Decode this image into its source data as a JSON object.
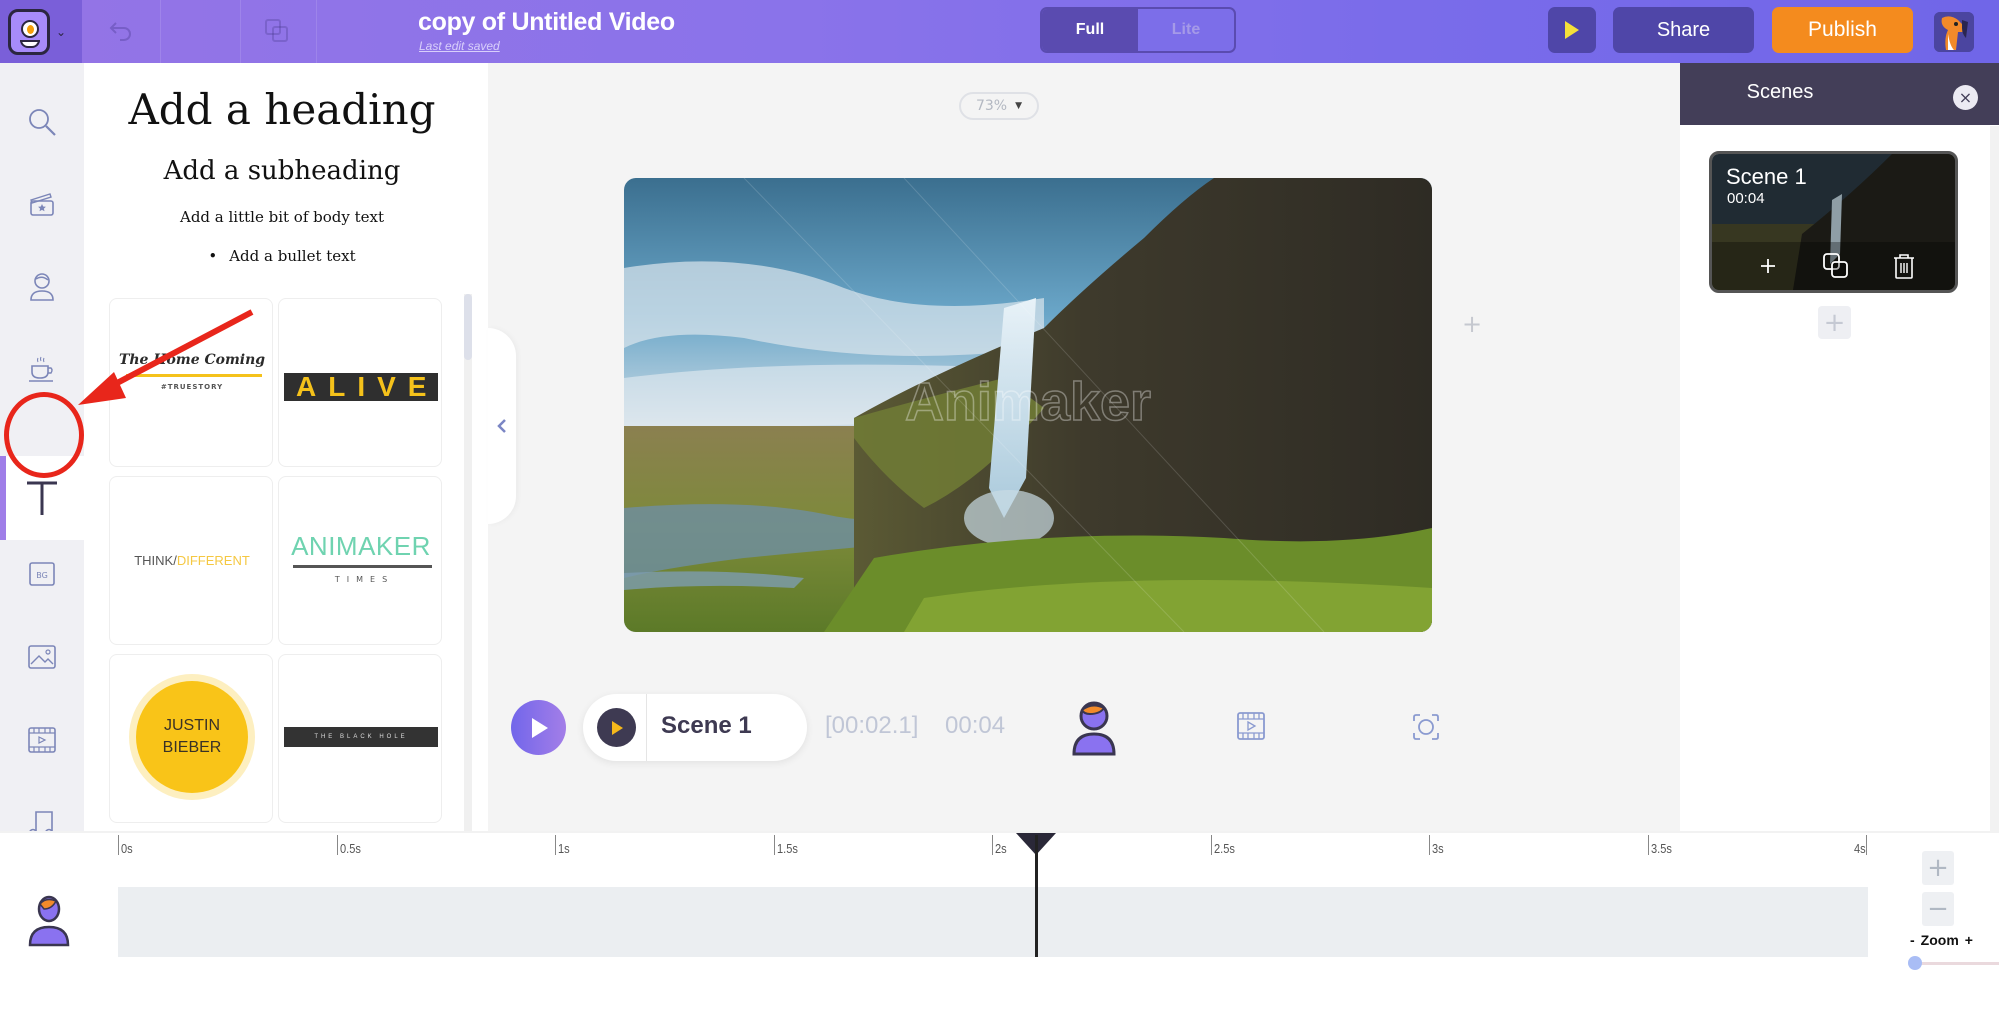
{
  "app": {
    "title": "copy of Untitled Video",
    "save_status": "Last edit saved"
  },
  "toolbar": {
    "mode_options": [
      "Full",
      "Lite"
    ],
    "mode_selected": "Full",
    "share_label": "Share",
    "publish_label": "Publish",
    "icons": [
      "app-logo-icon",
      "undo-icon",
      "duplicate-icon",
      "preview-play-icon",
      "user-avatar-icon"
    ]
  },
  "leftnav": {
    "items": [
      {
        "name": "search",
        "icon": "search-icon"
      },
      {
        "name": "scenes-templates",
        "icon": "clapperboard-star-icon"
      },
      {
        "name": "characters",
        "icon": "character-icon"
      },
      {
        "name": "properties",
        "icon": "coffee-cup-icon"
      },
      {
        "name": "text",
        "icon": "text-t-icon",
        "active": true
      },
      {
        "name": "backgrounds",
        "icon": "bg-icon",
        "label": "BG"
      },
      {
        "name": "images",
        "icon": "image-icon"
      },
      {
        "name": "videos",
        "icon": "film-icon"
      },
      {
        "name": "music",
        "icon": "music-note-icon"
      }
    ]
  },
  "textpanel": {
    "heading": "Add a heading",
    "subheading": "Add a subheading",
    "body": "Add a little bit of body text",
    "bullet": "Add a bullet text",
    "templates": [
      {
        "title": "The Home Coming",
        "subtitle": "#TRUESTORY"
      },
      {
        "title": "ALIVE"
      },
      {
        "title_part1": "THINK/",
        "title_part2": "DIFFERENT"
      },
      {
        "title": "ANIMAKER",
        "subtitle": "TIMES"
      },
      {
        "line1": "JUSTIN",
        "line2": "BIEBER"
      },
      {
        "title": "THE BLACK HOLE"
      }
    ]
  },
  "canvas": {
    "zoom_level": "73%",
    "watermark": "Animaker",
    "add_icon": "+"
  },
  "playback": {
    "scene_name": "Scene 1",
    "current_time": "[00:02.1]",
    "total_time": "00:04"
  },
  "scenes_panel": {
    "title": "Scenes",
    "close_icon": "×",
    "scenes": [
      {
        "name": "Scene 1",
        "duration": "00:04"
      }
    ],
    "add_scene_icon": "+"
  },
  "timeline": {
    "ticks": [
      "0s",
      "0.5s",
      "1s",
      "1.5s",
      "2s",
      "2.5s",
      "3s",
      "3.5s",
      "4s"
    ],
    "playhead_seconds": 2.1,
    "duration_seconds": 4,
    "zoom_label": "Zoom",
    "zoom_minus": "-",
    "zoom_plus": "+",
    "zoom_in_icon": "+",
    "zoom_out_icon": "−",
    "zoom_slider_value": 0
  },
  "colors": {
    "accent": "#7a6cea",
    "publish": "#f48b1e",
    "scenes_header": "#433e58",
    "annotation": "#e8261b"
  }
}
